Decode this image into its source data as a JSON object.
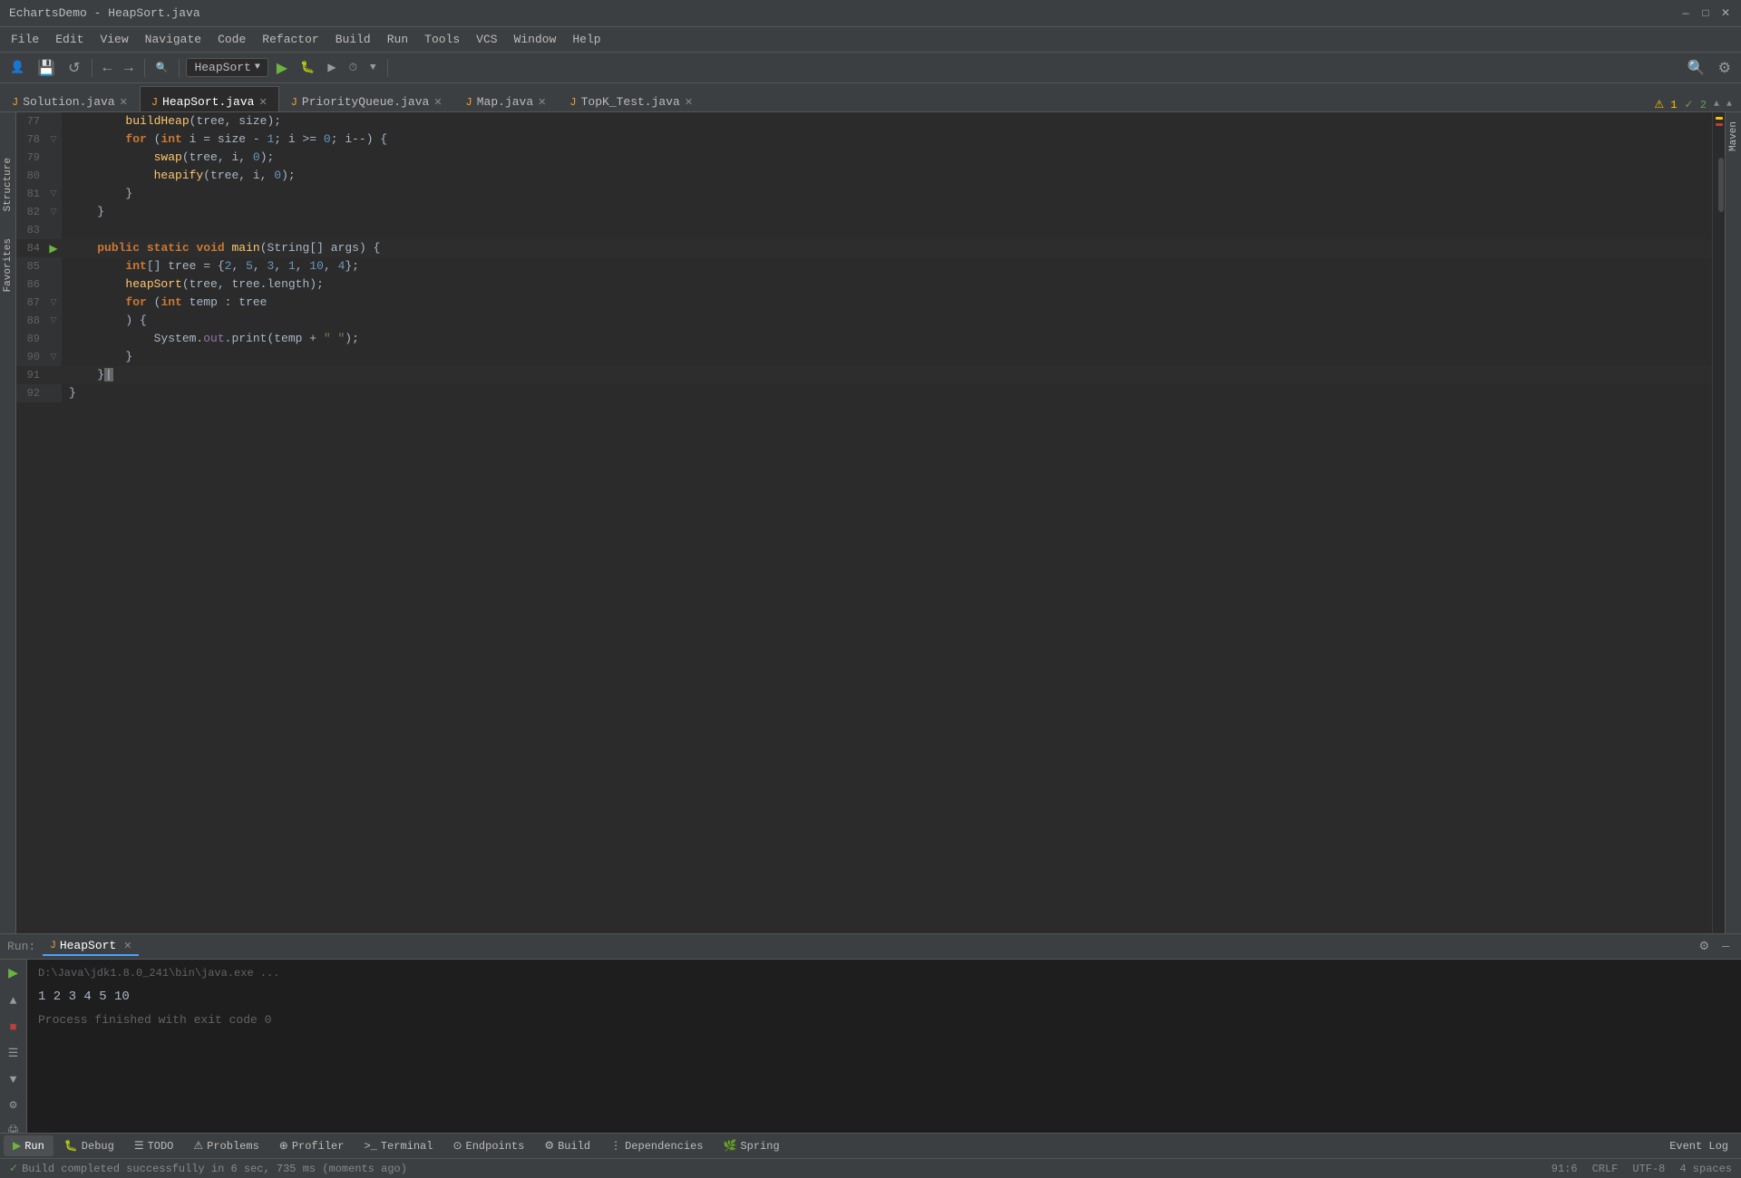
{
  "window": {
    "title": "EchartsDemo - HeapSort.java",
    "controls": {
      "minimize": "—",
      "maximize": "□",
      "close": "✕"
    }
  },
  "menu": {
    "items": [
      "File",
      "Edit",
      "View",
      "Navigate",
      "Code",
      "Refactor",
      "Build",
      "Run",
      "Tools",
      "VCS",
      "Window",
      "Help"
    ]
  },
  "toolbar": {
    "run_config": "HeapSort",
    "nav_back": "←",
    "nav_forward": "→"
  },
  "tabs": [
    {
      "label": "Solution.java",
      "active": false,
      "icon": "J"
    },
    {
      "label": "HeapSort.java",
      "active": true,
      "icon": "J"
    },
    {
      "label": "PriorityQueue.java",
      "active": false,
      "icon": "J"
    },
    {
      "label": "Map.java",
      "active": false,
      "icon": "J"
    },
    {
      "label": "TopK_Test.java",
      "active": false,
      "icon": "J"
    }
  ],
  "code_lines": [
    {
      "num": "77",
      "gutter": "",
      "code": "        buildHeap(tree, size);"
    },
    {
      "num": "78",
      "gutter": "▽",
      "code": "        for (int i = size - 1; i >= 0; i--) {"
    },
    {
      "num": "79",
      "gutter": "",
      "code": "            swap(tree, i, 0);"
    },
    {
      "num": "80",
      "gutter": "",
      "code": "            heapify(tree, i, 0);"
    },
    {
      "num": "81",
      "gutter": "▽",
      "code": "        }"
    },
    {
      "num": "82",
      "gutter": "▽",
      "code": "    }"
    },
    {
      "num": "83",
      "gutter": "",
      "code": ""
    },
    {
      "num": "84",
      "gutter": "▶",
      "code": "    public static void main(String[] args) {",
      "run_marker": true
    },
    {
      "num": "85",
      "gutter": "",
      "code": "        int[] tree = {2, 5, 3, 1, 10, 4};"
    },
    {
      "num": "86",
      "gutter": "",
      "code": "        heapSort(tree, tree.length);"
    },
    {
      "num": "87",
      "gutter": "▽",
      "code": "        for (int temp : tree"
    },
    {
      "num": "88",
      "gutter": "▽",
      "code": "        ) {"
    },
    {
      "num": "89",
      "gutter": "",
      "code": "            System.out.print(temp + \" \");"
    },
    {
      "num": "90",
      "gutter": "▽",
      "code": "        }"
    },
    {
      "num": "91",
      "gutter": "",
      "code": "    }"
    },
    {
      "num": "92",
      "gutter": "",
      "code": "}"
    }
  ],
  "warnings": {
    "label": "⚠ 1",
    "ok": "✓ 2"
  },
  "run_panel": {
    "title": "Run:",
    "tab": "HeapSort",
    "java_path": "D:\\Java\\jdk1.8.0_241\\bin\\java.exe ...",
    "output": "1 2 3 4 5 10",
    "process_status": "Process finished with exit code 0"
  },
  "bottom_tabs": [
    {
      "label": "Run",
      "icon": "▶",
      "active": true
    },
    {
      "label": "Debug",
      "icon": "🐛",
      "active": false
    },
    {
      "label": "TODO",
      "icon": "☰",
      "active": false
    },
    {
      "label": "Problems",
      "icon": "⚠",
      "active": false
    },
    {
      "label": "Profiler",
      "icon": "⊕",
      "active": false
    },
    {
      "label": "Terminal",
      "icon": ">_",
      "active": false
    },
    {
      "label": "Endpoints",
      "icon": "⊙",
      "active": false
    },
    {
      "label": "Build",
      "icon": "⚙",
      "active": false
    },
    {
      "label": "Dependencies",
      "icon": "⋮",
      "active": false
    },
    {
      "label": "Spring",
      "icon": "🌿",
      "active": false
    },
    {
      "label": "Event Log",
      "icon": "",
      "active": false
    }
  ],
  "status_bar": {
    "build_status": "Build completed successfully in 6 sec, 735 ms (moments ago)",
    "position": "91:6",
    "line_ending": "CRLF",
    "encoding": "UTF-8",
    "indent": "4 spaces"
  },
  "maven_label": "Maven"
}
